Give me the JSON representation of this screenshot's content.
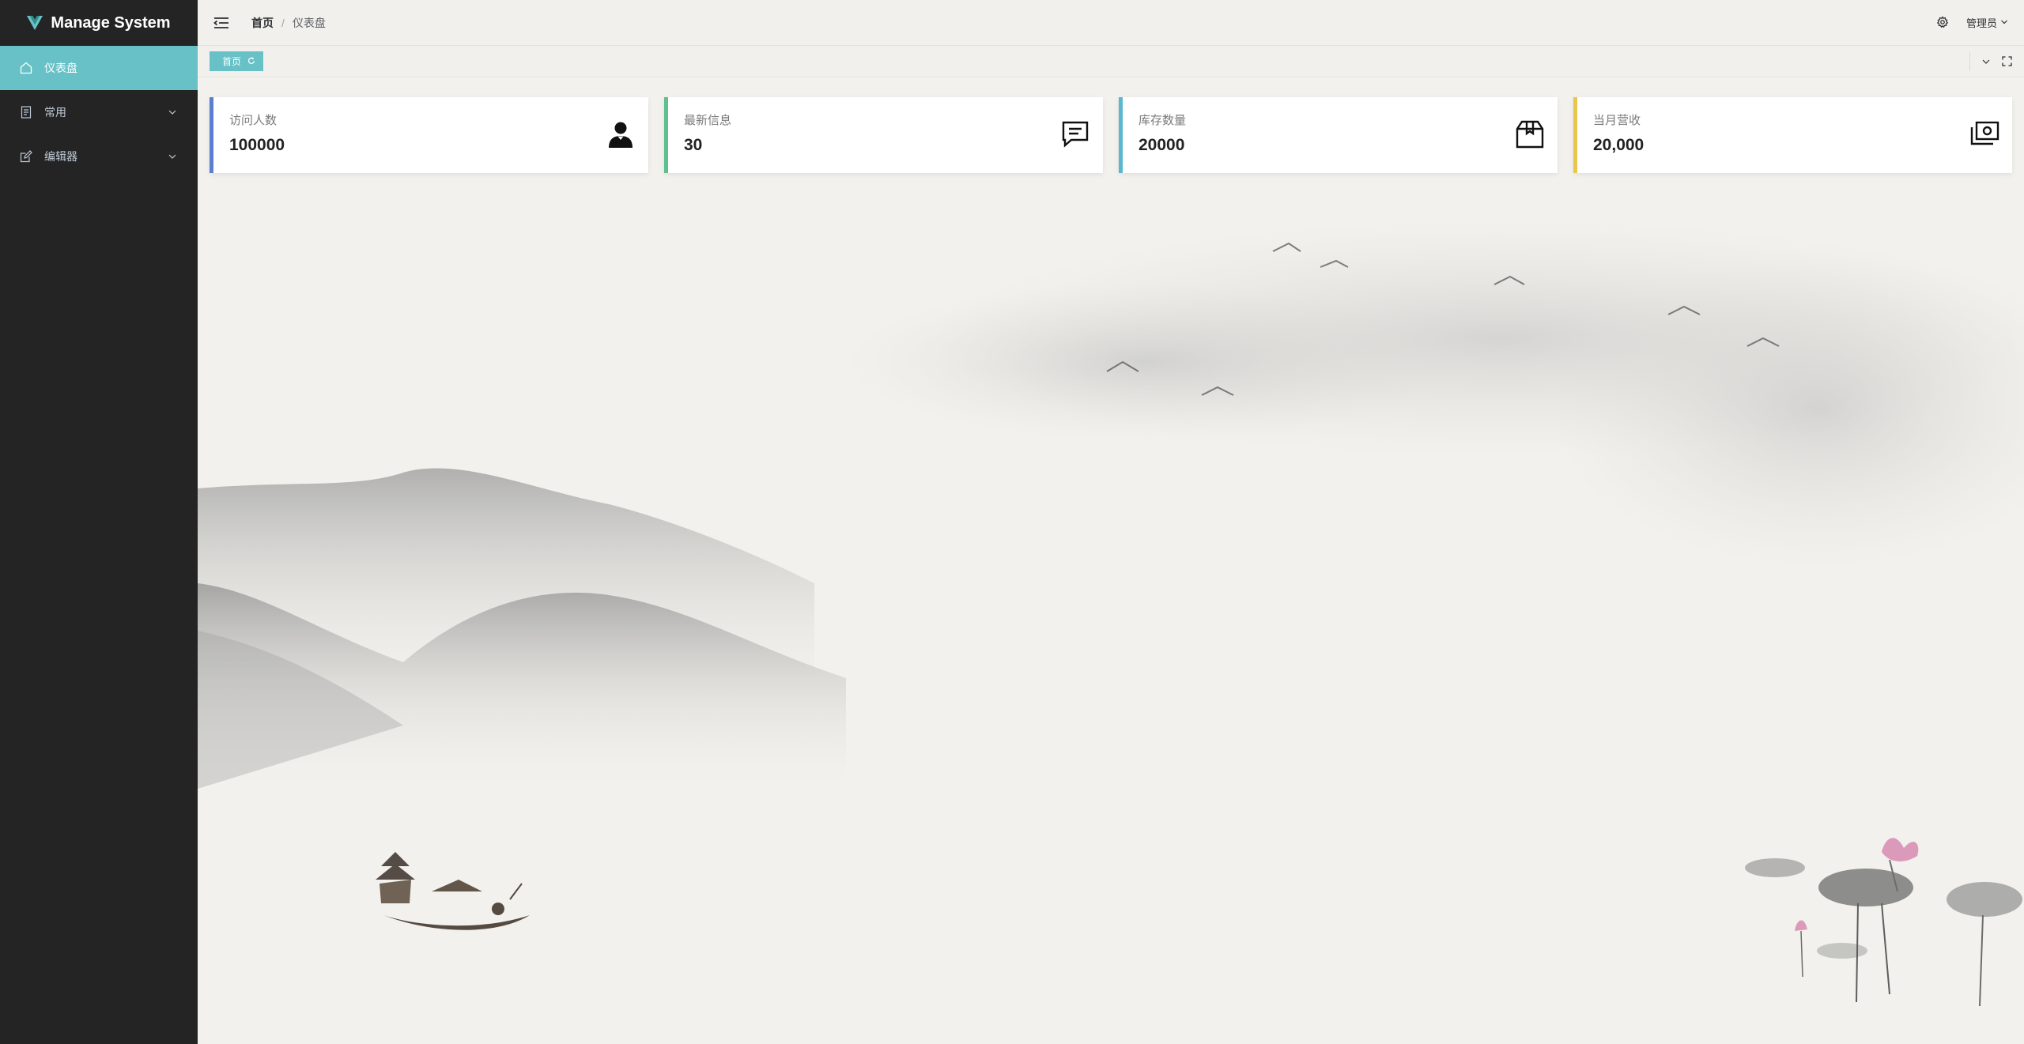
{
  "app": {
    "title": "Manage System"
  },
  "sidebar": {
    "items": [
      {
        "label": "仪表盘",
        "icon": "home-icon",
        "active": true
      },
      {
        "label": "常用",
        "icon": "document-icon",
        "expandable": true
      },
      {
        "label": "编辑器",
        "icon": "edit-icon",
        "expandable": true
      }
    ]
  },
  "header": {
    "breadcrumb": {
      "home": "首页",
      "separator": "/",
      "current": "仪表盘"
    },
    "user": "管理员"
  },
  "tags": {
    "items": [
      {
        "label": "首页"
      }
    ]
  },
  "stats": [
    {
      "label": "访问人数",
      "value": "100000",
      "icon": "user-icon",
      "color": "#5b7ed2"
    },
    {
      "label": "最新信息",
      "value": "30",
      "icon": "message-icon",
      "color": "#5fbf8e"
    },
    {
      "label": "库存数量",
      "value": "20000",
      "icon": "box-icon",
      "color": "#5ab7d1"
    },
    {
      "label": "当月营收",
      "value": "20,000",
      "icon": "money-icon",
      "color": "#e8c74a"
    }
  ],
  "colors": {
    "sidebar_bg": "#242424",
    "accent": "#67c1c6",
    "background": "#f2f1ed"
  }
}
